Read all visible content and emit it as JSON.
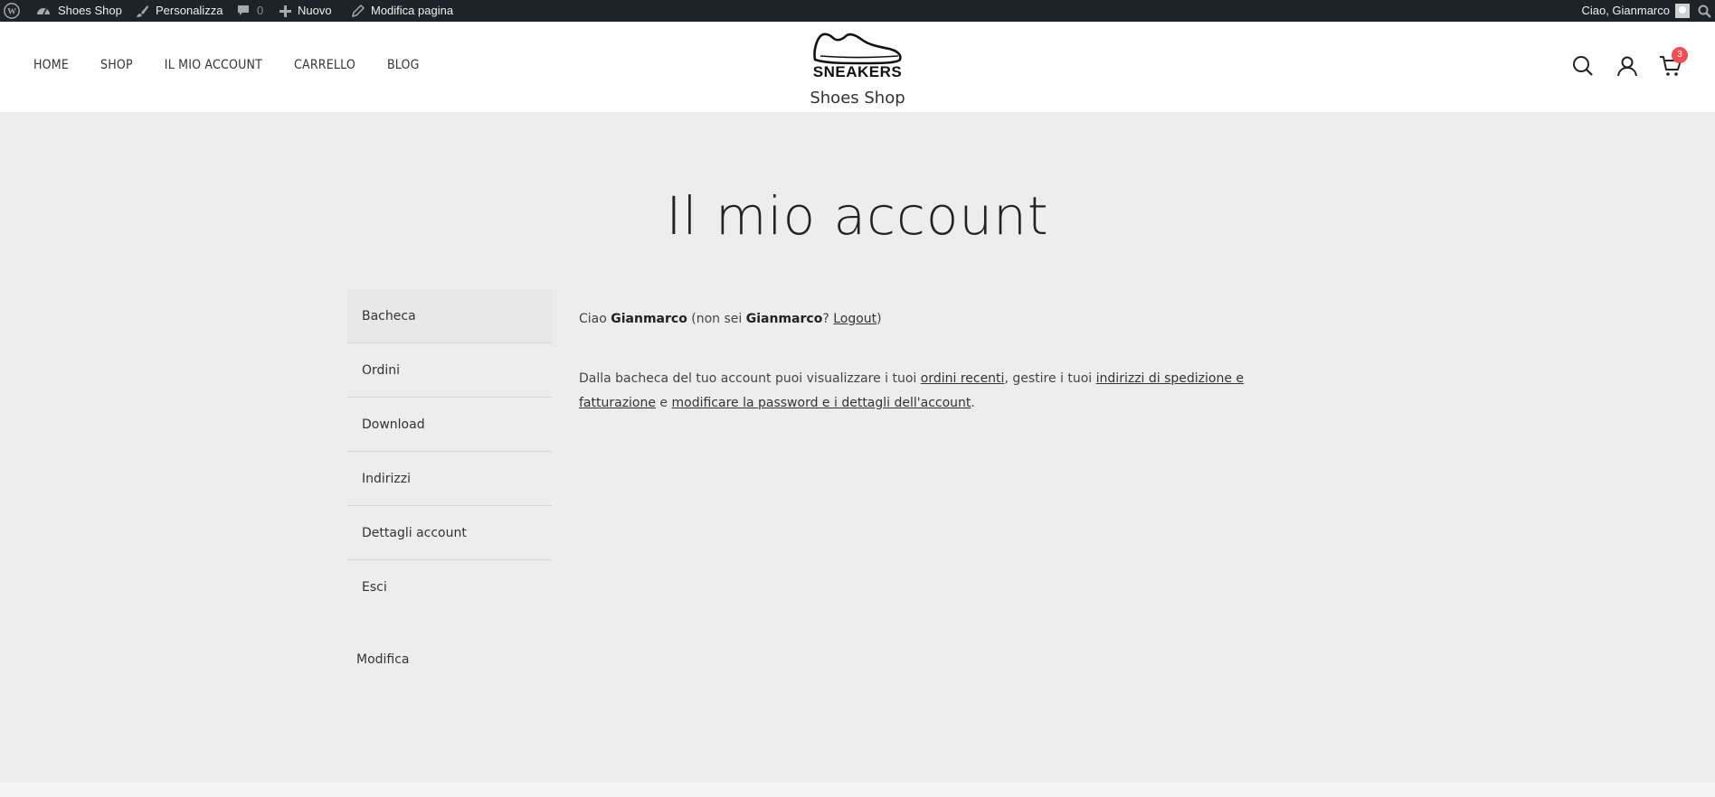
{
  "adminbar": {
    "site_name": "Shoes Shop",
    "customize": "Personalizza",
    "comments_count": "0",
    "new": "Nuovo",
    "edit_page": "Modifica pagina",
    "greeting": "Ciao, Gianmarco"
  },
  "nav": {
    "items": [
      {
        "label": "HOME"
      },
      {
        "label": "SHOP"
      },
      {
        "label": "IL MIO ACCOUNT"
      },
      {
        "label": "CARRELLO"
      },
      {
        "label": "BLOG"
      }
    ]
  },
  "logo": {
    "text": "SNEAKERS"
  },
  "site_title": "Shoes Shop",
  "cart": {
    "count": "3"
  },
  "page": {
    "title": "Il mio account"
  },
  "sidebar": {
    "items": [
      {
        "label": "Bacheca"
      },
      {
        "label": "Ordini"
      },
      {
        "label": "Download"
      },
      {
        "label": "Indirizzi"
      },
      {
        "label": "Dettagli account"
      },
      {
        "label": "Esci"
      }
    ],
    "edit": "Modifica"
  },
  "content": {
    "hello_prefix": "Ciao ",
    "user": "Gianmarco",
    "not_you_prefix": " (non sei ",
    "not_you_user": "Gianmarco",
    "not_you_suffix": "? ",
    "logout": "Logout",
    "close_paren": ")",
    "dash_prefix": "Dalla bacheca del tuo account puoi visualizzare i tuoi ",
    "recent_orders": "ordini recenti",
    "dash_mid1": ", gestire i tuoi ",
    "addresses": "indirizzi di spedizione e fatturazione",
    "dash_mid2": " e ",
    "edit_account": "modificare la password e i dettagli dell'account",
    "dash_end": "."
  },
  "colors": {
    "badge": "#ef4f55",
    "adminbar": "#1d2327",
    "background": "#ededed"
  }
}
